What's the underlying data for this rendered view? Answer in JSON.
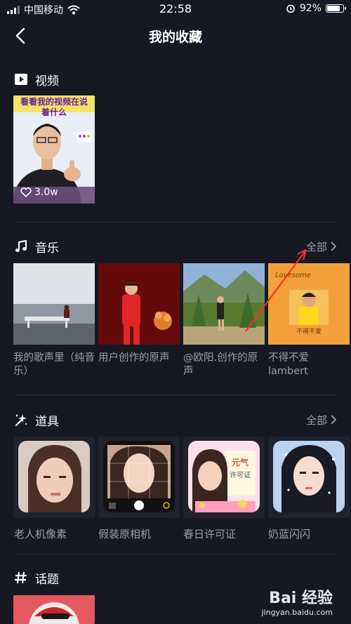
{
  "status_bar": {
    "carrier": "中国移动",
    "time": "22:58",
    "battery": "92%",
    "battery_level": 0.92
  },
  "header": {
    "title": "我的收藏"
  },
  "sections": {
    "video": {
      "label": "视频",
      "items": [
        {
          "caption_line1": "看看我的视频在说",
          "caption_line2": "着什么",
          "likes": "3.0w"
        }
      ]
    },
    "music": {
      "label": "音乐",
      "all_label": "全部",
      "items": [
        {
          "title": "我的歌声里（纯音乐）"
        },
        {
          "title": "用户创作的原声"
        },
        {
          "title": "@欧阳.创作的原声"
        },
        {
          "title": "不得不爱 lambert"
        }
      ],
      "album_text": {
        "top": "Lovesome",
        "bottom": "不得不爱"
      }
    },
    "props": {
      "label": "道具",
      "all_label": "全部",
      "items": [
        {
          "title": "老人机像素"
        },
        {
          "title": "假装原相机"
        },
        {
          "title": "春日许可证",
          "badge_top": "元气",
          "badge_bottom": "许可证"
        },
        {
          "title": "奶蓝闪闪"
        }
      ]
    },
    "topics": {
      "label": "话题"
    }
  },
  "watermark": {
    "logo": "Bai 经验",
    "sub": "jingyan.baidu.com"
  },
  "colors": {
    "background": "#161823",
    "muted": "#9da0a8",
    "arrow": "#ff2a2a"
  }
}
